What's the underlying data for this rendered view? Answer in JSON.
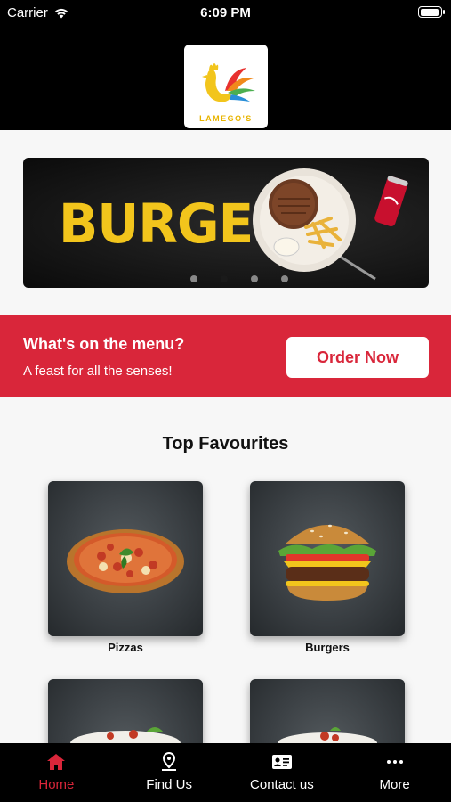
{
  "status_bar": {
    "carrier": "Carrier",
    "time": "6:09 PM"
  },
  "header": {
    "logo_text": "LAMEGO'S"
  },
  "banner": {
    "title": "BURGER",
    "slide_count": 4,
    "active_slide": 2
  },
  "promo": {
    "title": "What's on the menu?",
    "subtitle": "A feast for all the senses!",
    "button_label": "Order Now"
  },
  "favourites": {
    "title": "Top Favourites",
    "items": [
      {
        "label": "Pizzas"
      },
      {
        "label": "Burgers"
      },
      {
        "label": ""
      },
      {
        "label": ""
      }
    ]
  },
  "tabbar": {
    "tabs": [
      {
        "label": "Home",
        "icon": "home-icon",
        "active": true
      },
      {
        "label": "Find Us",
        "icon": "location-pin-icon",
        "active": false
      },
      {
        "label": "Contact us",
        "icon": "contact-card-icon",
        "active": false
      },
      {
        "label": "More",
        "icon": "more-dots-icon",
        "active": false
      }
    ]
  },
  "colors": {
    "brand_red": "#d9263a",
    "banner_yellow": "#f2c51c",
    "header_bg": "#000000"
  }
}
